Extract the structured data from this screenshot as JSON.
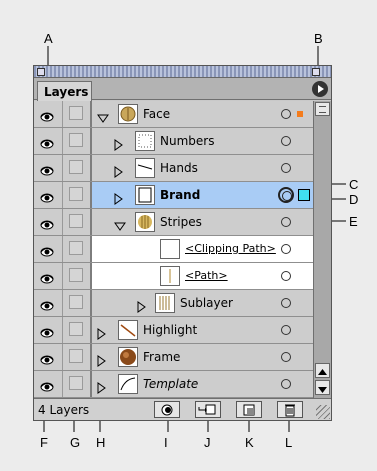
{
  "callouts": {
    "top": [
      "A",
      "B"
    ],
    "right": [
      "C",
      "D",
      "E"
    ],
    "bottom": [
      "F",
      "G",
      "H",
      "I",
      "J",
      "K",
      "L"
    ]
  },
  "panel": {
    "tab_label": "Layers",
    "status_text": "4 Layers",
    "layers": [
      {
        "name": "Face",
        "expanded": true,
        "target_circle": "single",
        "indicator": "orange-square"
      },
      {
        "name": "Numbers",
        "expanded": false,
        "target_circle": "single"
      },
      {
        "name": "Hands",
        "expanded": false,
        "target_circle": "single"
      },
      {
        "name": "Brand",
        "expanded": false,
        "target_circle": "double",
        "selected": true,
        "indicator": "cyan-square"
      },
      {
        "name": "Stripes",
        "expanded": true,
        "target_circle": "single"
      },
      {
        "name": "<Clipping Path>",
        "target_circle": "single"
      },
      {
        "name": "<Path>",
        "target_circle": "single"
      },
      {
        "name": "Sublayer",
        "expanded": false,
        "target_circle": "single"
      },
      {
        "name": "Highlight",
        "expanded": false,
        "target_circle": "single"
      },
      {
        "name": "Frame",
        "expanded": false,
        "target_circle": "single"
      },
      {
        "name": "Template",
        "expanded": false,
        "target_circle": "single",
        "template": true
      }
    ],
    "bottom_buttons": [
      "make-clipping-mask-icon",
      "new-sublayer-icon",
      "new-layer-icon",
      "trash-icon"
    ]
  },
  "colors": {
    "selection": "#a9ccf5",
    "orange_indicator": "#f47c1c",
    "cyan_indicator": "#40e0f0"
  }
}
